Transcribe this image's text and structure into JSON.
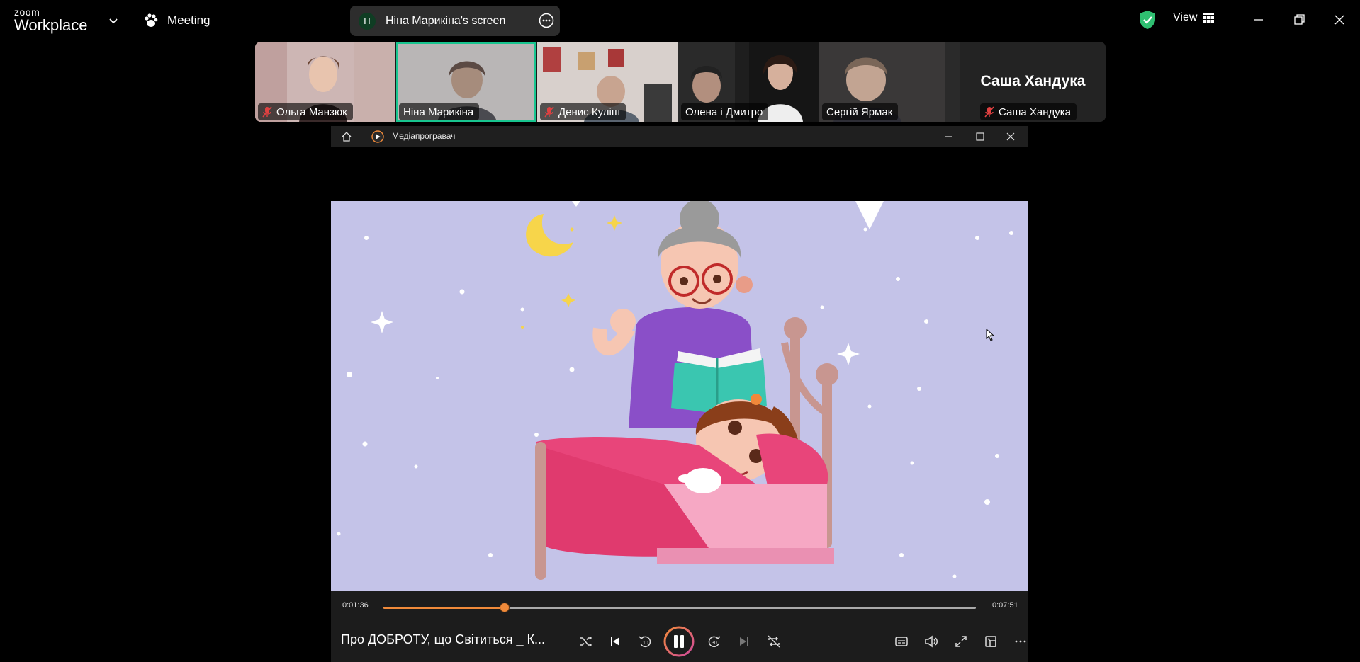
{
  "app": {
    "logo_top": "zoom",
    "logo_bottom": "Workplace",
    "meeting_label": "Meeting",
    "share": {
      "avatar_letter": "H",
      "label": "Ніна Марикіна's screen"
    },
    "view_label": "View",
    "shield_color": "#2fbf71",
    "accent_active_speaker": "#18c58f"
  },
  "participants": [
    {
      "name": "Ольга Манзюк",
      "muted": true
    },
    {
      "name": "Ніна Марикіна",
      "muted": false,
      "active": true
    },
    {
      "name": "Денис Куліш",
      "muted": true
    },
    {
      "name": "Олена і Дмитро",
      "muted": false
    },
    {
      "name": "Сергій Ярмак",
      "muted": false
    },
    {
      "name": "Саша Хандука",
      "muted": true,
      "display_name": "Саша Хандука"
    }
  ],
  "player": {
    "title": "Медіапрогравач",
    "elapsed": "0:01:36",
    "total": "0:07:51",
    "progress_fraction": 0.204,
    "video_title": "Про ДОБРОТУ, що Світиться _ К...",
    "accent": "#f08a3a"
  }
}
